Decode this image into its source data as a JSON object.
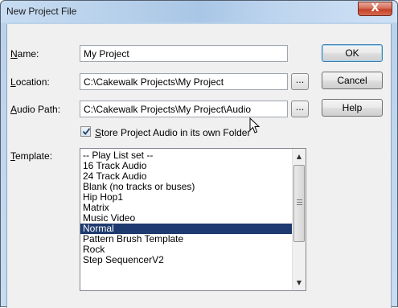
{
  "window": {
    "title": "New Project File",
    "close_label": "X"
  },
  "form": {
    "name_label_key": "N",
    "name_label_rest": "ame:",
    "name_value": "My Project",
    "location_label_key": "L",
    "location_label_rest": "ocation:",
    "location_value": "C:\\Cakewalk Projects\\My Project",
    "audio_label_key": "A",
    "audio_label_rest": "udio Path:",
    "audio_value": "C:\\Cakewalk Projects\\My Project\\Audio",
    "browse_label": "...",
    "store_key": "S",
    "store_rest": "tore Project Audio in its own Folder",
    "store_checked": true,
    "template_label_key": "T",
    "template_label_rest": "emplate:"
  },
  "buttons": {
    "ok": "OK",
    "cancel": "Cancel",
    "help": "Help"
  },
  "template_list": {
    "items": [
      "-- Play List set --",
      "16 Track Audio",
      "24 Track Audio",
      "Blank (no tracks or buses)",
      "Hip Hop1",
      "Matrix",
      "Music Video",
      "Normal",
      "Pattern Brush Template",
      "Rock",
      "Step SequencerV2"
    ],
    "selected": "Normal",
    "scroll_fraction": 0.1
  },
  "icons": {
    "scroll_up": "scroll-up-arrow-icon",
    "scroll_down": "scroll-down-arrow-icon",
    "cursor": "mouse-pointer-icon",
    "check": "checkmark-icon",
    "close": "close-icon"
  }
}
